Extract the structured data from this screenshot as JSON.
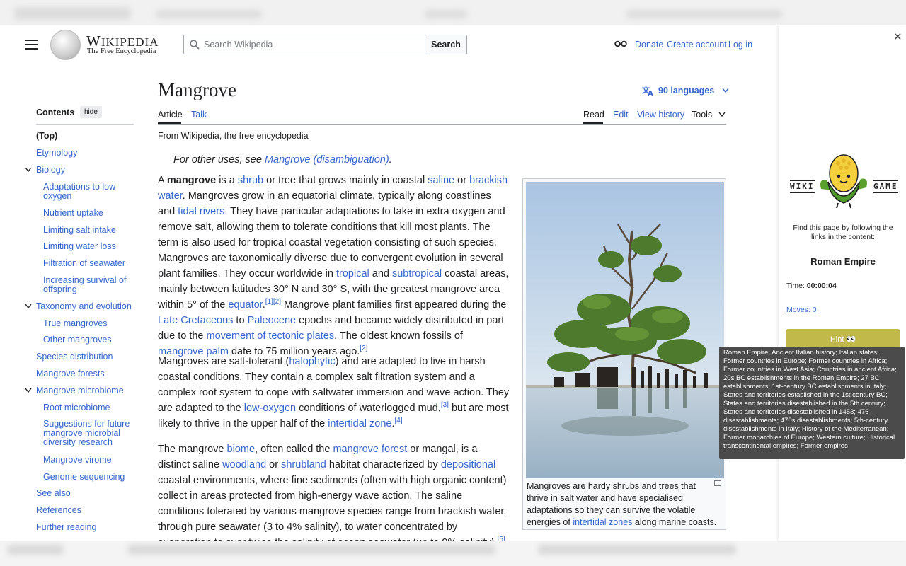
{
  "wiki": {
    "wordmark": "Wikipedia",
    "tagline": "The Free Encyclopedia",
    "search_placeholder": "Search Wikipedia",
    "search_button": "Search",
    "donate": "Donate",
    "create_account": "Create account",
    "login": "Log in"
  },
  "toc": {
    "title": "Contents",
    "hide": "hide",
    "items": [
      "(Top)",
      "Etymology",
      "Biology",
      "Adaptations to low oxygen",
      "Nutrient uptake",
      "Limiting salt intake",
      "Limiting water loss",
      "Filtration of seawater",
      "Increasing survival of offspring",
      "Taxonomy and evolution",
      "True mangroves",
      "Other mangroves",
      "Species distribution",
      "Mangrove forests",
      "Mangrove microbiome",
      "Root microbiome",
      "Suggestions for future mangrove microbial diversity research",
      "Mangrove virome",
      "Genome sequencing",
      "See also",
      "References",
      "Further reading"
    ]
  },
  "article": {
    "title": "Mangrove",
    "languages": "90 languages",
    "tabs": {
      "article": "Article",
      "talk": "Talk",
      "read": "Read",
      "edit": "Edit",
      "history": "View history",
      "tools": "Tools"
    },
    "from": "From Wikipedia, the free encyclopedia",
    "hatnote_prefix": "For other uses, see ",
    "hatnote_link": "Mangrove (disambiguation)",
    "hatnote_suffix": ".",
    "caption_text": "Mangroves are hardy shrubs and trees that thrive in salt water and have specialised adaptations so they can survive the volatile energies of ",
    "caption_link": "intertidal zones",
    "caption_end": " along marine coasts."
  },
  "game": {
    "logo_left": "WIKI",
    "logo_right": "GAME",
    "instructions": "Find this page by following the links in the content:",
    "target": "Roman Empire",
    "time_label": "Time:",
    "time_value": "00:00:04",
    "moves": "Moves: 0",
    "hint": "Hint 👀",
    "tooltip": "Roman Empire; Ancient Italian history; Italian states; Former countries in Europe; Former countries in Africa; Former countries in West Asia; Countries in ancient Africa; 20s BC establishments in the Roman Empire; 27 BC establishments; 1st-century BC establishments in Italy; States and territories established in the 1st century BC; States and territories disestablished in the 5th century; States and territories disestablished in 1453; 476 disestablishments; 470s disestablishments; 5th-century disestablishments in Italy; History of the Mediterranean; Former monarchies of Europe; Western culture; Historical transcontinental empires; Former empires"
  },
  "colors": {
    "link": "#3366cc",
    "hint": "#c2b94b",
    "tooltip_bg": "#4b4b4b"
  }
}
